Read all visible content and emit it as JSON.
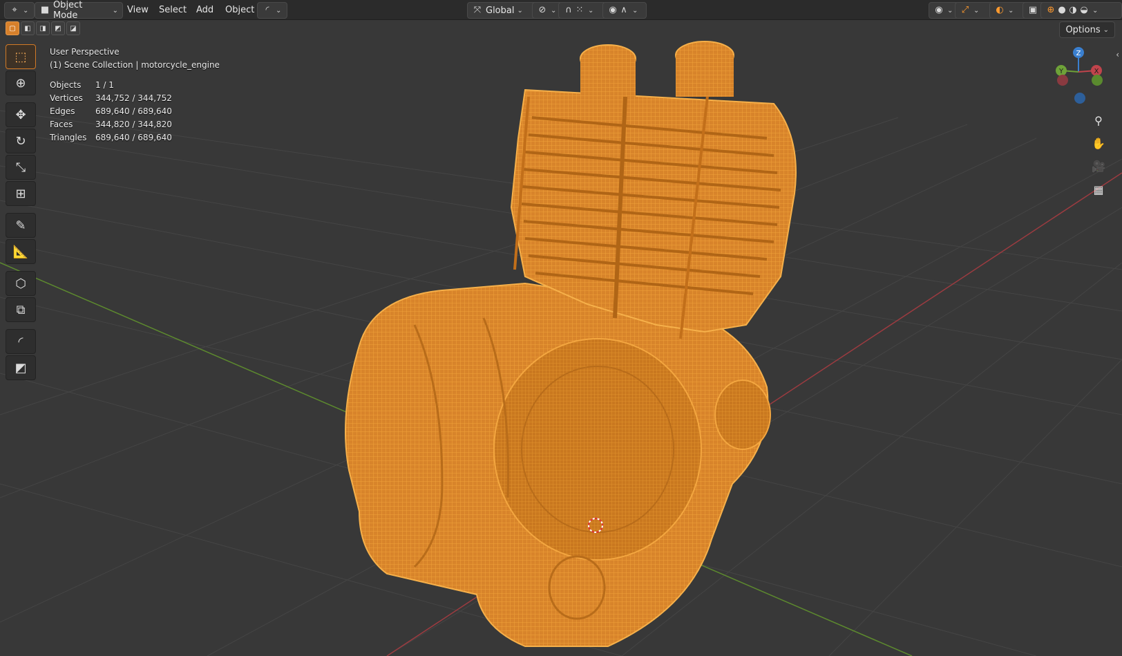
{
  "header": {
    "mode_label": "Object Mode",
    "menus": [
      "View",
      "Select",
      "Add",
      "Object"
    ],
    "orientation_label": "Global",
    "options_label": "Options"
  },
  "overlay": {
    "view_name": "User Perspective",
    "collection_line": "(1) Scene Collection | motorcycle_engine",
    "stats": [
      {
        "label": "Objects",
        "value": "1 / 1"
      },
      {
        "label": "Vertices",
        "value": "344,752 / 344,752"
      },
      {
        "label": "Edges",
        "value": "689,640 / 689,640"
      },
      {
        "label": "Faces",
        "value": "344,820 / 344,820"
      },
      {
        "label": "Triangles",
        "value": "689,640 / 689,640"
      }
    ]
  },
  "gizmo": {
    "z_label": "Z",
    "y_label": "Y",
    "x_label": "X"
  },
  "colors": {
    "accent": "#e08a2b",
    "mesh_orange": "#e69a2f",
    "axis_x": "#c0444c",
    "axis_y": "#6ea238",
    "axis_z": "#3a7fcf",
    "background": "#393939"
  },
  "toolbar_icons": [
    "select-box-icon",
    "cursor-icon",
    "move-icon",
    "rotate-icon",
    "scale-icon",
    "transform-icon",
    "annotate-icon",
    "measure-icon",
    "add-cube-icon",
    "shear-icon",
    "curve-icon",
    "box-icon"
  ]
}
